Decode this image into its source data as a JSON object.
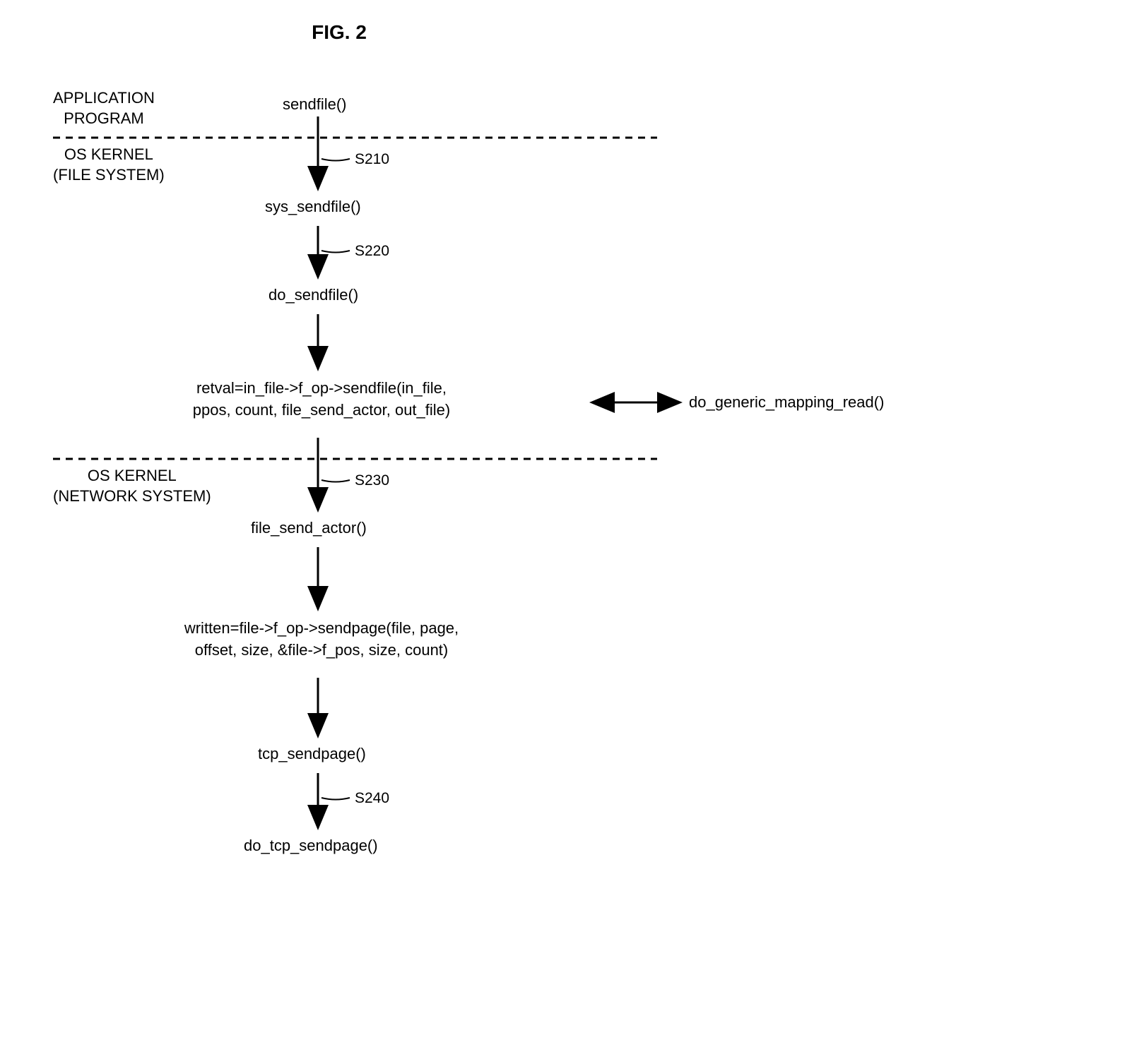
{
  "figure_title": "FIG. 2",
  "layers": {
    "app": "APPLICATION\nPROGRAM",
    "fs": "OS KERNEL\n(FILE SYSTEM)",
    "net": "OS KERNEL\n(NETWORK SYSTEM)"
  },
  "nodes": {
    "sendfile": "sendfile()",
    "sys_sendfile": "sys_sendfile()",
    "do_sendfile": "do_sendfile()",
    "retval": "retval=in_file->f_op->sendfile(in_file,\nppos, count, file_send_actor, out_file)",
    "do_generic": "do_generic_mapping_read()",
    "file_send_actor": "file_send_actor()",
    "written": "written=file->f_op->sendpage(file, page,\noffset, size, &file->f_pos, size, count)",
    "tcp_sendpage": "tcp_sendpage()",
    "do_tcp_sendpage": "do_tcp_sendpage()"
  },
  "steps": {
    "s210": "S210",
    "s220": "S220",
    "s230": "S230",
    "s240": "S240"
  }
}
